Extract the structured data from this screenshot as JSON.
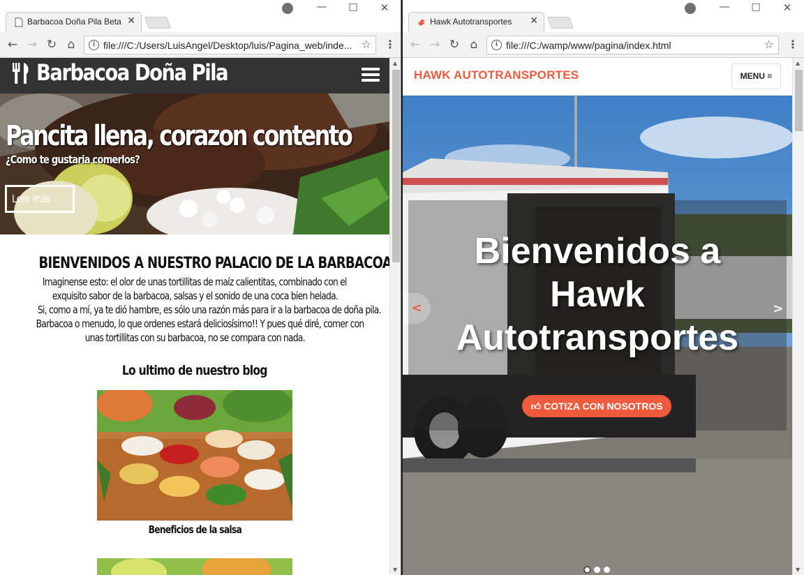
{
  "left_window": {
    "tab_title": "Barbacoa Doña Pila Beta",
    "url": "file:///C:/Users/LuisAngel/Desktop/luis/Pagina_web/inde...",
    "site": {
      "logo": "Barbacoa Doña Pila",
      "hero_title": "Pancita llena, corazon contento",
      "hero_subtitle": "¿Como te gustaria comerlos?",
      "hero_button": "Leer más",
      "heading": "BIENVENIDOS A NUESTRO PALACIO DE LA BARBACOA",
      "paragraph_lines": [
        "Imaginense esto: el olor de unas tortillitas de maíz calientitas, combinado con el",
        "exquisito sabor de la barbacoa, salsas y el sonido de una coca bien helada.",
        "Si, como a mí, ya te dió hambre, es sólo una razón más para ir a la barbacoa de doña pila.",
        "Barbacoa o menudo, lo que ordenes estará deliciosísimo!! Y pues qué diré, comer con",
        "unas tortillitas con su barbacoa, no se compara con nada."
      ],
      "blog_title": "Lo ultimo de nuestro blog",
      "blog_caption": "Beneficios de la salsa"
    }
  },
  "right_window": {
    "tab_title": "Hawk Autotransportes",
    "url": "file:///C:/wamp/www/pagina/index.html",
    "site": {
      "brand": "HAWK AUTOTRANSPORTES",
      "menu_button": "MENU ≡",
      "hero_lines": [
        "Bienvenidos a",
        "Hawk",
        "Autotransportes"
      ],
      "cta_button": "COTIZA CON NOSOTROS",
      "prev": "<",
      "next": ">",
      "carousel_dots": 3,
      "active_dot": 1
    }
  },
  "colors": {
    "hawk_accent": "#ef5a3c",
    "bbq_nav": "#333333"
  }
}
